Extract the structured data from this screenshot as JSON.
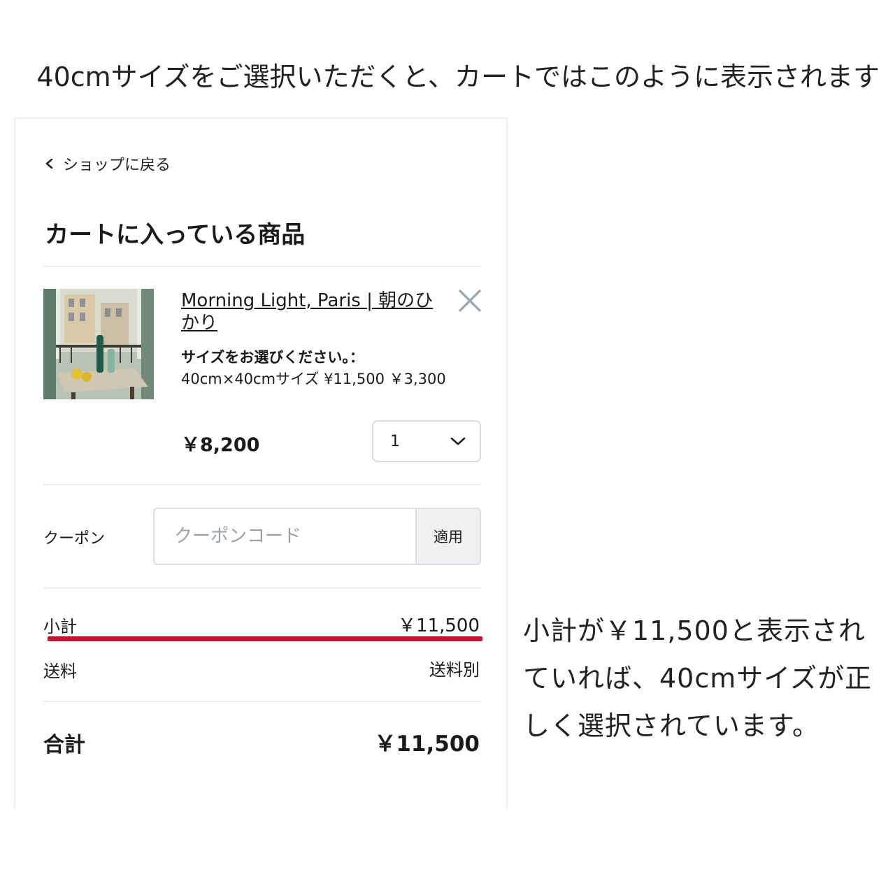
{
  "headline": {
    "icon": "pushpin-icon",
    "text": "40cmサイズをご選択いただくと、カートではこのように表示されます"
  },
  "cart": {
    "back_label": "ショップに戻る",
    "title": "カートに入っている商品",
    "item": {
      "name": "Morning Light, Paris | 朝のひかり",
      "option_label": "サイズをお選びください。：",
      "option_value": "40cm×40cmサイズ ¥11,500 ￥3,300",
      "price": "￥8,200",
      "quantity": "1"
    },
    "coupon": {
      "label": "クーポン",
      "placeholder": "クーポンコード",
      "apply_label": "適用"
    },
    "subtotal": {
      "label": "小計",
      "value": "￥11,500"
    },
    "shipping": {
      "label": "送料",
      "value": "送料別"
    },
    "total": {
      "label": "合計",
      "value": "￥11,500"
    },
    "highlight_color": "#c8102e"
  },
  "note": {
    "text": "小計が￥11,500と表示されていれば、40cmサイズが正しく選択されています。"
  }
}
